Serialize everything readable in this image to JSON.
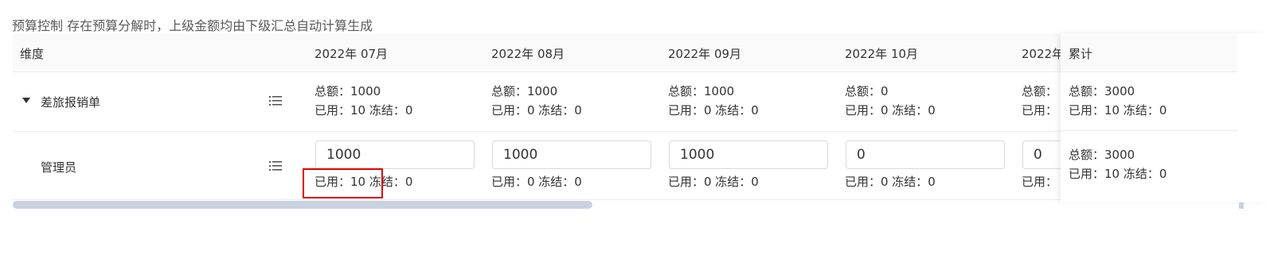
{
  "caption": "预算控制 存在预算分解时，上级金额均由下级汇总自动计算生成",
  "table": {
    "dim_header": "维度",
    "months": [
      "2022年 07月",
      "2022年 08月",
      "2022年 09月",
      "2022年 10月",
      "2022年"
    ],
    "total_header": "累计",
    "row1": {
      "name": "差旅报销单",
      "cells": [
        {
          "total": "总额：1000",
          "used": "已用：10 冻结：0"
        },
        {
          "total": "总额：1000",
          "used": "已用：0 冻结：0"
        },
        {
          "total": "总额：1000",
          "used": "已用：0 冻结：0"
        },
        {
          "total": "总额：0",
          "used": "已用：0 冻结：0"
        },
        {
          "total": "总额：",
          "used": "已用："
        }
      ],
      "summary": {
        "total": "总额：3000",
        "used": "已用：10   冻结：0"
      }
    },
    "row2": {
      "name": "管理员",
      "inputs": [
        "1000",
        "1000",
        "1000",
        "0",
        "0"
      ],
      "used": [
        "已用：10 冻结：0",
        "已用：0 冻结：0",
        "已用：0 冻结：0",
        "已用：0 冻结：0",
        "已用："
      ],
      "summary": {
        "total": "总额：3000",
        "used": "已用：10   冻结：0"
      }
    }
  },
  "colors": {
    "highlight": "#e00000",
    "scrollbar": "#c9d2df",
    "header_bg": "#fafafa"
  },
  "icons": {
    "expand": "caret-down-icon",
    "detail": "list-icon"
  }
}
